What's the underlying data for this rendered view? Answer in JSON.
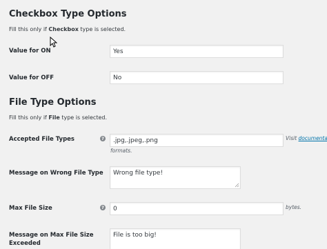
{
  "checkbox_section": {
    "title": "Checkbox Type Options",
    "desc_prefix": "Fill this only if ",
    "desc_bold": "Checkbox",
    "desc_suffix": " type is selected.",
    "value_on_label": "Value for ON",
    "value_on": "Yes",
    "value_off_label": "Value for OFF",
    "value_off": "No"
  },
  "file_section": {
    "title": "File Type Options",
    "desc_prefix": "Fill this only if ",
    "desc_bold": "File",
    "desc_suffix": " type is selected.",
    "accepted_label": "Accepted File Types",
    "accepted_value": ".jpg,.jpeg,.png",
    "accepted_hint_prefix": "Visit ",
    "accepted_hint_link": "documentati",
    "accepted_hint_suffix": "formats.",
    "wrong_type_label": "Message on Wrong File Type",
    "wrong_type_value": "Wrong file type!",
    "max_size_label": "Max File Size",
    "max_size_value": "0",
    "max_size_unit": "bytes.",
    "max_exceeded_label_1": "Message on Max File Size",
    "max_exceeded_label_2": "Exceeded",
    "max_exceeded_value": "File is too big!"
  },
  "icons": {
    "help": "question-circle-icon",
    "cursor": "mouse-pointer-icon"
  },
  "colors": {
    "background": "#f1f1f1",
    "link": "#0073aa",
    "help_icon": "#82878c"
  }
}
